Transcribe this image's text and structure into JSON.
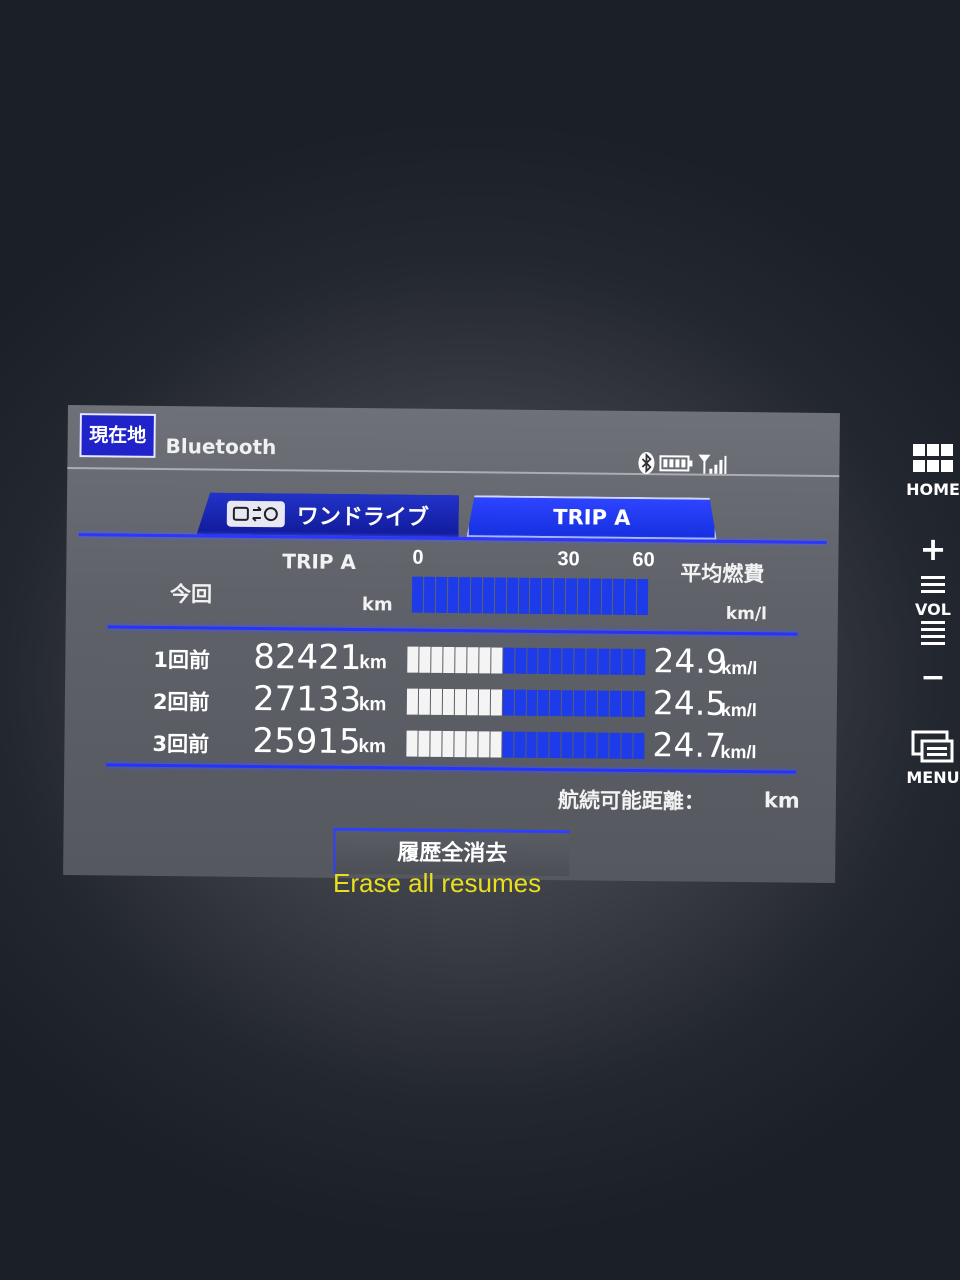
{
  "header": {
    "location_button": "現在地",
    "source_label": "Bluetooth"
  },
  "status_icons": [
    "bluetooth-icon",
    "battery-icon",
    "signal-icon"
  ],
  "tabs": [
    {
      "label": "ワンドライブ",
      "icon": "one-drive-icon",
      "active": false
    },
    {
      "label": "TRIP A",
      "active": true
    }
  ],
  "current": {
    "row_label": "今回",
    "column_label": "TRIP A",
    "distance_unit": "km",
    "efficiency_label": "平均燃費",
    "efficiency_unit": "km/l",
    "scale_ticks": [
      "0",
      "30",
      "60"
    ]
  },
  "history": [
    {
      "label": "1回前",
      "distance": "82421",
      "distance_unit": "km",
      "efficiency": "24.9",
      "efficiency_unit": "km/l"
    },
    {
      "label": "2回前",
      "distance": "27133",
      "distance_unit": "km",
      "efficiency": "24.5",
      "efficiency_unit": "km/l"
    },
    {
      "label": "3回前",
      "distance": "25915",
      "distance_unit": "km",
      "efficiency": "24.7",
      "efficiency_unit": "km/l"
    }
  ],
  "range": {
    "label": "航続可能距離：",
    "unit": "km"
  },
  "erase_button": "履歴全消去",
  "caption": "Erase all resumes",
  "side_buttons": {
    "home": "HOME",
    "vol_up": "+",
    "vol": "VOL",
    "vol_down": "−",
    "menu": "MENU"
  },
  "colors": {
    "accent": "#2433ff",
    "bar_white": "#f4f4f4",
    "bar_blue": "#1d3be8",
    "caption": "#e8df1e"
  }
}
